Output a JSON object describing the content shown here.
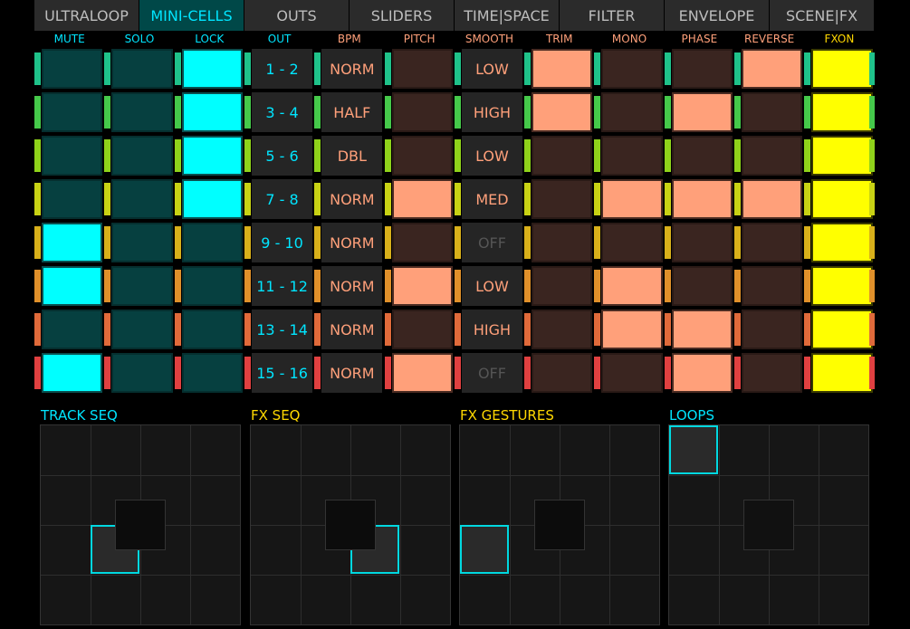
{
  "tabs": [
    "ULTRALOOP",
    "MINI-CELLS",
    "OUTS",
    "SLIDERS",
    "TIME|SPACE",
    "FILTER",
    "ENVELOPE",
    "SCENE|FX"
  ],
  "active_tab": "MINI-CELLS",
  "columns": [
    {
      "label": "MUTE",
      "color": "#00e5ff"
    },
    {
      "label": "SOLO",
      "color": "#00e5ff"
    },
    {
      "label": "LOCK",
      "color": "#00e5ff"
    },
    {
      "label": "OUT",
      "color": "#00e5ff"
    },
    {
      "label": "BPM",
      "color": "#ffa07a"
    },
    {
      "label": "PITCH",
      "color": "#ffa07a"
    },
    {
      "label": "SMOOTH",
      "color": "#ffa07a"
    },
    {
      "label": "TRIM",
      "color": "#ffa07a"
    },
    {
      "label": "MONO",
      "color": "#ffa07a"
    },
    {
      "label": "PHASE",
      "color": "#ffa07a"
    },
    {
      "label": "REVERSE",
      "color": "#ffa07a"
    },
    {
      "label": "FXON",
      "color": "#ffd800"
    }
  ],
  "rows": [
    {
      "stripe": "#1fc28a",
      "out": "1 - 2",
      "bpm": "NORM",
      "smooth": "LOW",
      "mute": false,
      "solo": false,
      "lock": true,
      "pitch": false,
      "trim": true,
      "mono": false,
      "phase": false,
      "reverse": true,
      "fxon": true
    },
    {
      "stripe": "#45c94a",
      "out": "3 - 4",
      "bpm": "HALF",
      "smooth": "HIGH",
      "mute": false,
      "solo": false,
      "lock": true,
      "pitch": false,
      "trim": true,
      "mono": false,
      "phase": true,
      "reverse": false,
      "fxon": true
    },
    {
      "stripe": "#8fd21a",
      "out": "5 - 6",
      "bpm": "DBL",
      "smooth": "LOW",
      "mute": false,
      "solo": false,
      "lock": true,
      "pitch": false,
      "trim": false,
      "mono": false,
      "phase": false,
      "reverse": false,
      "fxon": true
    },
    {
      "stripe": "#c8d214",
      "out": "7 - 8",
      "bpm": "NORM",
      "smooth": "MED",
      "mute": false,
      "solo": false,
      "lock": true,
      "pitch": true,
      "trim": false,
      "mono": true,
      "phase": true,
      "reverse": true,
      "fxon": true
    },
    {
      "stripe": "#d8b01a",
      "out": "9 - 10",
      "bpm": "NORM",
      "smooth": "OFF",
      "mute": true,
      "solo": false,
      "lock": false,
      "pitch": false,
      "trim": false,
      "mono": false,
      "phase": false,
      "reverse": false,
      "fxon": true
    },
    {
      "stripe": "#e0902a",
      "out": "11 - 12",
      "bpm": "NORM",
      "smooth": "LOW",
      "mute": true,
      "solo": false,
      "lock": false,
      "pitch": true,
      "trim": false,
      "mono": true,
      "phase": false,
      "reverse": false,
      "fxon": true
    },
    {
      "stripe": "#e06a3a",
      "out": "13 - 14",
      "bpm": "NORM",
      "smooth": "HIGH",
      "mute": false,
      "solo": false,
      "lock": false,
      "pitch": false,
      "trim": false,
      "mono": true,
      "phase": true,
      "reverse": false,
      "fxon": true
    },
    {
      "stripe": "#e04040",
      "out": "15 - 16",
      "bpm": "NORM",
      "smooth": "OFF",
      "mute": true,
      "solo": false,
      "lock": false,
      "pitch": true,
      "trim": false,
      "mono": false,
      "phase": true,
      "reverse": false,
      "fxon": true
    }
  ],
  "pads": [
    {
      "title": "TRACK SEQ",
      "title_color": "#00e5ff"
    },
    {
      "title": "FX SEQ",
      "title_color": "#ffd800"
    },
    {
      "title": "FX GESTURES",
      "title_color": "#ffd800"
    },
    {
      "title": "LOOPS",
      "title_color": "#00e5ff"
    }
  ]
}
